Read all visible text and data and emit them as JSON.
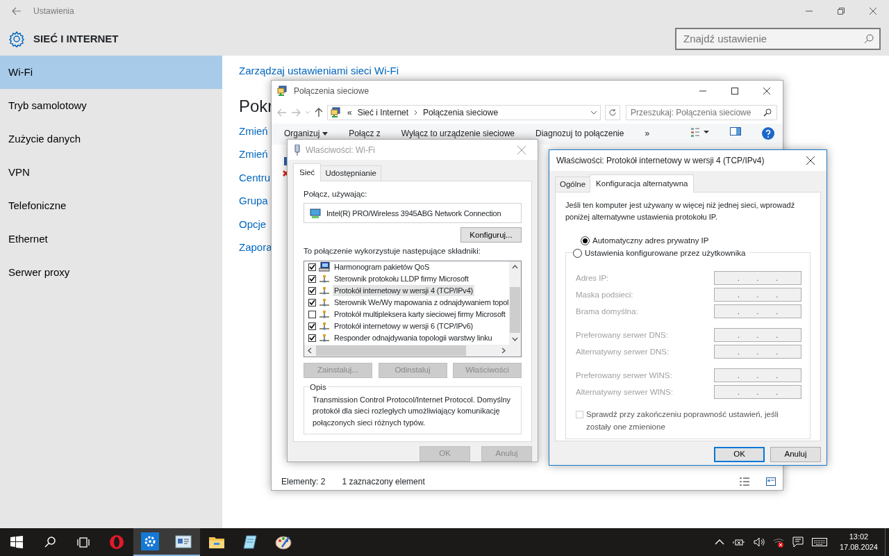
{
  "settings": {
    "title": "Ustawienia",
    "heading": "SIEĆ I INTERNET",
    "search": {
      "placeholder": "Znajdź ustawienie"
    },
    "nav": [
      {
        "label": "Wi-Fi",
        "selected": true
      },
      {
        "label": "Tryb samolotowy",
        "selected": false
      },
      {
        "label": "Zużycie danych",
        "selected": false
      },
      {
        "label": "VPN",
        "selected": false
      },
      {
        "label": "Telefoniczne",
        "selected": false
      },
      {
        "label": "Ethernet",
        "selected": false
      },
      {
        "label": "Serwer proxy",
        "selected": false
      }
    ],
    "content": {
      "top_link": "Zarządzaj ustawieniami sieci Wi-Fi",
      "heading": "Pokr",
      "links": [
        "Zmień",
        "Zmień",
        "Centru",
        "Grupa",
        "Opcje",
        "Zapora"
      ]
    }
  },
  "explorer": {
    "title": "Połączenia sieciowe",
    "address_prefix": "«",
    "address": [
      "Sieć i Internet",
      "Połączenia sieciowe"
    ],
    "search": {
      "placeholder": "Przeszukaj: Połączenia sieciowe"
    },
    "toolbar": [
      {
        "label": "Organizuj",
        "dropdown": true
      },
      {
        "label": "Połącz z",
        "dropdown": false
      },
      {
        "label": "Wyłącz to urządzenie sieciowe",
        "dropdown": false
      },
      {
        "label": "Diagnozuj to połączenie",
        "dropdown": false
      },
      {
        "label": "»",
        "dropdown": false
      }
    ],
    "status": [
      "Elementy: 2",
      "1 zaznaczony element"
    ]
  },
  "wifi_dialog": {
    "title": "Właściwości: Wi-Fi",
    "active": false,
    "tabs": [
      {
        "label": "Sieć",
        "selected": true
      },
      {
        "label": "Udostępnianie",
        "selected": false
      }
    ],
    "connect_label": "Połącz, używając:",
    "adapter": "Intel(R) PRO/Wireless 3945ABG Network Connection",
    "configure_button": "Konfiguruj...",
    "components_label": "To połączenie wykorzystuje następujące składniki:",
    "components": [
      {
        "label": "Harmonogram pakietów QoS",
        "checked": true,
        "selected": false,
        "kind": "scheduler"
      },
      {
        "label": "Sterownik protokołu LLDP firmy Microsoft",
        "checked": true,
        "selected": false,
        "kind": "protocol"
      },
      {
        "label": "Protokół internetowy w wersji 4 (TCP/IPv4)",
        "checked": true,
        "selected": true,
        "kind": "protocol"
      },
      {
        "label": "Sterownik We/Wy mapowania z odnajdywaniem topol",
        "checked": true,
        "selected": false,
        "kind": "protocol"
      },
      {
        "label": "Protokół multipleksera karty sieciowej firmy Microsoft",
        "checked": false,
        "selected": false,
        "kind": "protocol"
      },
      {
        "label": "Protokół internetowy w wersji 6 (TCP/IPv6)",
        "checked": true,
        "selected": false,
        "kind": "protocol"
      },
      {
        "label": "Responder odnajdywania topologii warstwy linku",
        "checked": true,
        "selected": false,
        "kind": "protocol"
      }
    ],
    "buttons": [
      {
        "label": "Zainstaluj...",
        "disabled": true
      },
      {
        "label": "Odinstaluj",
        "disabled": true
      },
      {
        "label": "Właściwości",
        "disabled": true
      }
    ],
    "description_title": "Opis",
    "description": "Transmission Control Protocol/Internet Protocol. Domyślny protokół dla sieci rozległych umożliwiający komunikację połączonych sieci różnych typów.",
    "footer_buttons": [
      {
        "label": "OK",
        "disabled": true
      },
      {
        "label": "Anuluj",
        "disabled": true
      }
    ]
  },
  "ipv4_dialog": {
    "title": "Właściwości: Protokół internetowy w wersji 4 (TCP/IPv4)",
    "active": true,
    "tabs": [
      {
        "label": "Ogólne",
        "selected": false
      },
      {
        "label": "Konfiguracja alternatywna",
        "selected": true
      }
    ],
    "intro": "Jeśli ten komputer jest używany w więcej niż jednej sieci, wprowadź poniżej alternatywne ustawienia protokołu IP.",
    "radios": [
      {
        "label": "Automatyczny adres prywatny IP",
        "selected": true
      },
      {
        "label": "Ustawienia konfigurowane przez użytkownika",
        "selected": false
      }
    ],
    "field_groups": [
      [
        {
          "label": "Adres IP:",
          "value": ". . .",
          "disabled": true
        },
        {
          "label": "Maska podsieci:",
          "value": ". . .",
          "disabled": true
        },
        {
          "label": "Brama domyślna:",
          "value": ". . .",
          "disabled": true
        }
      ],
      [
        {
          "label": "Preferowany serwer DNS:",
          "value": ". . .",
          "disabled": true
        },
        {
          "label": "Alternatywny serwer DNS:",
          "value": ". . .",
          "disabled": true
        }
      ],
      [
        {
          "label": "Preferowany serwer WINS:",
          "value": ". . .",
          "disabled": true
        },
        {
          "label": "Alternatywny serwer WINS:",
          "value": ". . .",
          "disabled": true
        }
      ]
    ],
    "validate": {
      "label": "Sprawdź przy zakończeniu poprawność ustawień, jeśli zostały one zmienione",
      "checked": false,
      "disabled": true
    },
    "footer_buttons": [
      {
        "label": "OK",
        "default": true
      },
      {
        "label": "Anuluj",
        "default": false
      }
    ]
  },
  "taskbar": {
    "apps": [
      {
        "kind": "browser",
        "active": false
      },
      {
        "kind": "settings",
        "active": true
      },
      {
        "kind": "network",
        "active": true
      },
      {
        "kind": "folder",
        "active": false
      },
      {
        "kind": "notepad",
        "active": false
      },
      {
        "kind": "paint",
        "active": false
      }
    ],
    "clock": {
      "time": "13:02",
      "date": "17.08.2024"
    }
  }
}
